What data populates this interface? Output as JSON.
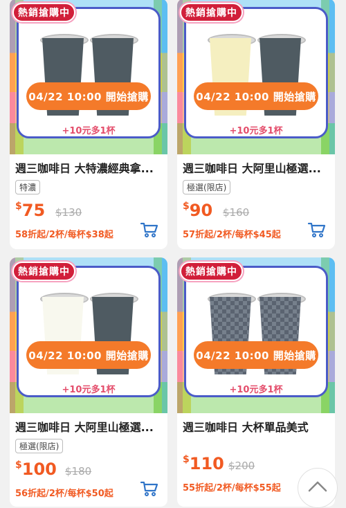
{
  "products": [
    {
      "badge": "熱銷搶購中",
      "sale_time": "04/22 10:00 開始搶購",
      "promo": "+10元多1杯",
      "title": "週三咖啡日 大特濃經典拿...",
      "tag": "特濃",
      "currency": "$",
      "price": "75",
      "orig": "$130",
      "discount": "58折起/2杯/每杯$38起"
    },
    {
      "badge": "熱銷搶購中",
      "sale_time": "04/22 10:00 開始搶購",
      "promo": "+10元多1杯",
      "title": "週三咖啡日 大阿里山極選...",
      "tag": "極選(限店)",
      "currency": "$",
      "price": "90",
      "orig": "$160",
      "discount": "57折起/2杯/每杯$45起"
    },
    {
      "badge": "熱銷搶購中",
      "sale_time": "04/22 10:00 開始搶購",
      "promo": "+10元多1杯",
      "title": "週三咖啡日 大阿里山極選...",
      "tag": "極選(限店)",
      "currency": "$",
      "price": "100",
      "orig": "$180",
      "discount": "56折起/2杯/每杯$50起"
    },
    {
      "badge": "熱銷搶購中",
      "sale_time": "04/22 10:00 開始搶購",
      "promo": "+10元多1杯",
      "title": "週三咖啡日 大杯單品美式",
      "tag": "",
      "currency": "$",
      "price": "110",
      "orig": "$200",
      "discount": "55折起/2杯/每杯$55起"
    }
  ],
  "icons": {
    "cart": "cart-icon",
    "scroll_top": "chevron-up-icon"
  },
  "colors": {
    "accent": "#f15a22",
    "badge": "#d11f3a",
    "cart": "#2f74c8"
  }
}
